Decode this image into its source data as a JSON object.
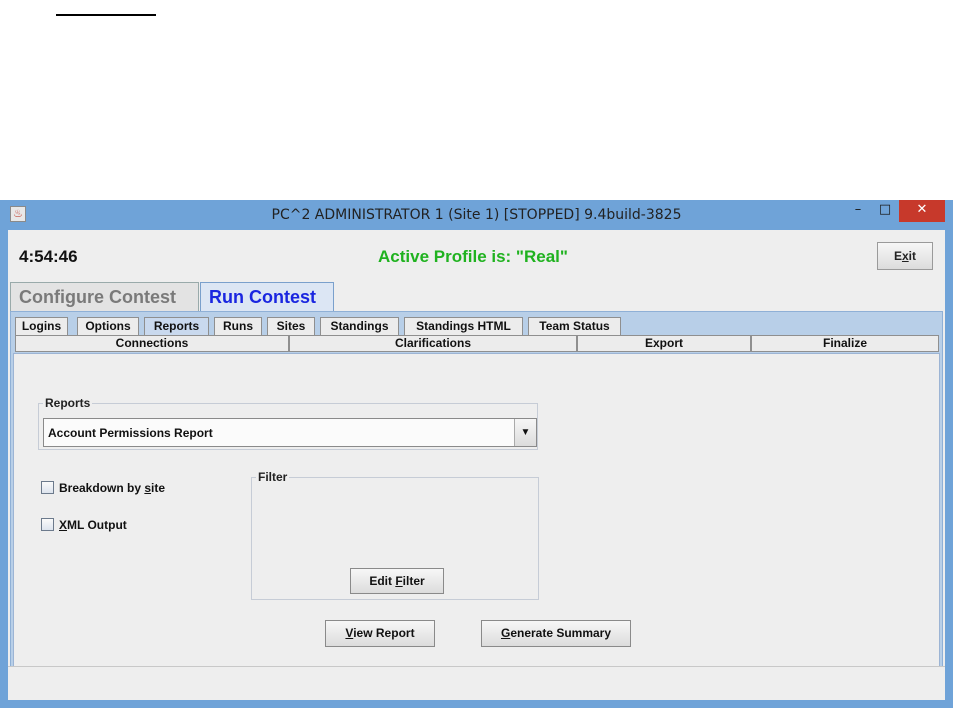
{
  "window": {
    "title": "PC^2 ADMINISTRATOR 1 (Site 1) [STOPPED] 9.4build-3825",
    "minimize_glyph": "–",
    "maximize_glyph": "□",
    "close_glyph": "✕"
  },
  "header": {
    "clock": "4:54:46",
    "active_profile": "Active Profile is: \"Real\"",
    "exit_label_pre": "E",
    "exit_label_mnemonic": "x",
    "exit_label_post": "it"
  },
  "main_tabs": [
    {
      "label": "Configure Contest",
      "selected": false
    },
    {
      "label": "Run Contest",
      "selected": true
    }
  ],
  "sub_tabs_row1": [
    "Logins",
    "Options",
    "Reports",
    "Runs",
    "Sites",
    "Standings",
    "Standings HTML",
    "Team Status"
  ],
  "sub_tabs_row2": [
    "Connections",
    "Clarifications",
    "Export",
    "Finalize"
  ],
  "reports": {
    "legend": "Reports",
    "selected": "Account Permissions Report",
    "arrow_glyph": "▼"
  },
  "options": {
    "breakdown_pre": "Breakdown by ",
    "breakdown_mnemonic": "s",
    "breakdown_post": "ite",
    "breakdown_checked": false,
    "xml_mnemonic": "X",
    "xml_post": "ML Output",
    "xml_checked": false
  },
  "filter": {
    "legend": "Filter",
    "edit_pre": "Edit ",
    "edit_mnemonic": "F",
    "edit_post": "ilter"
  },
  "buttons": {
    "view_mnemonic": "V",
    "view_post": "iew Report",
    "gen_mnemonic": "G",
    "gen_post": "enerate Summary"
  },
  "colors": {
    "titlebar": "#6fa3d8",
    "profile_green": "#1fb21f",
    "run_tab_blue": "#1a26e0",
    "close_red": "#c7392b"
  }
}
